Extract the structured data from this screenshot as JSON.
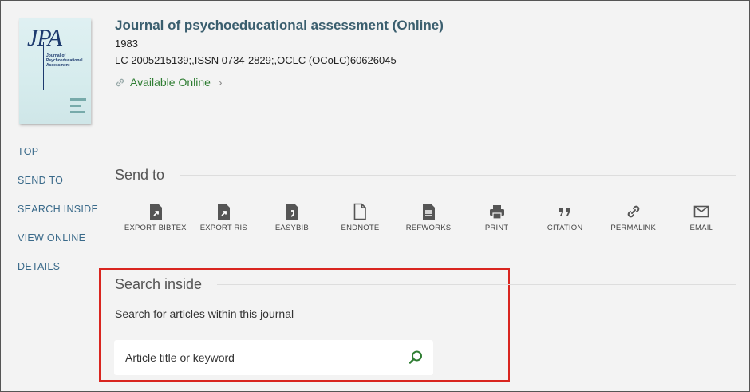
{
  "record": {
    "title": "Journal of psychoeducational assessment (Online)",
    "year": "1983",
    "identifiers": "LC 2005215139;,ISSN 0734-2829;,OCLC (OCoLC)60626045",
    "availability": "Available Online",
    "cover": {
      "logo_text": "JPA",
      "subtitle": "Journal of Psychoeducational Assessment"
    }
  },
  "nav": {
    "items": [
      {
        "label": "TOP"
      },
      {
        "label": "SEND TO"
      },
      {
        "label": "SEARCH INSIDE"
      },
      {
        "label": "VIEW ONLINE"
      },
      {
        "label": "DETAILS"
      }
    ]
  },
  "send_to": {
    "title": "Send to",
    "actions": [
      {
        "label": "EXPORT BIBTEX",
        "icon": "export-file-icon"
      },
      {
        "label": "EXPORT RIS",
        "icon": "export-file-icon"
      },
      {
        "label": "EASYBIB",
        "icon": "easybib-icon"
      },
      {
        "label": "ENDNOTE",
        "icon": "document-icon"
      },
      {
        "label": "REFWORKS",
        "icon": "text-document-icon"
      },
      {
        "label": "PRINT",
        "icon": "printer-icon"
      },
      {
        "label": "CITATION",
        "icon": "quote-icon"
      },
      {
        "label": "PERMALINK",
        "icon": "link-icon"
      },
      {
        "label": "EMAIL",
        "icon": "envelope-icon"
      }
    ]
  },
  "search_inside": {
    "title": "Search inside",
    "description": "Search for articles within this journal",
    "placeholder": "Article title or keyword"
  },
  "colors": {
    "accent_green": "#2e7d32",
    "title_color": "#3a5e6e",
    "highlight_border": "#d9251f",
    "background": "#f3f3f3"
  }
}
